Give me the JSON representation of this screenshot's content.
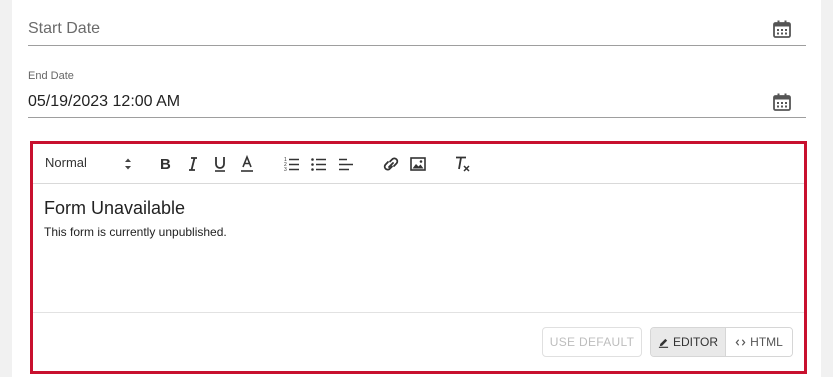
{
  "dates": {
    "start": {
      "placeholder": "Start Date",
      "icon": "calendar-icon"
    },
    "end": {
      "label": "End Date",
      "value": "05/19/2023 12:00 AM",
      "icon": "calendar-icon"
    }
  },
  "editor": {
    "border_color": "#c8102e",
    "format_select": {
      "value": "Normal"
    },
    "toolbar_icons": [
      "bold-icon",
      "italic-icon",
      "underline-icon",
      "text-color-icon",
      "ordered-list-icon",
      "bullet-list-icon",
      "align-icon",
      "link-icon",
      "image-icon",
      "clear-format-icon"
    ],
    "content": {
      "heading": "Form Unavailable",
      "body": "This form is currently unpublished."
    },
    "footer": {
      "use_default_label": "USE DEFAULT",
      "editor_label": "EDITOR",
      "html_label": "HTML"
    }
  }
}
